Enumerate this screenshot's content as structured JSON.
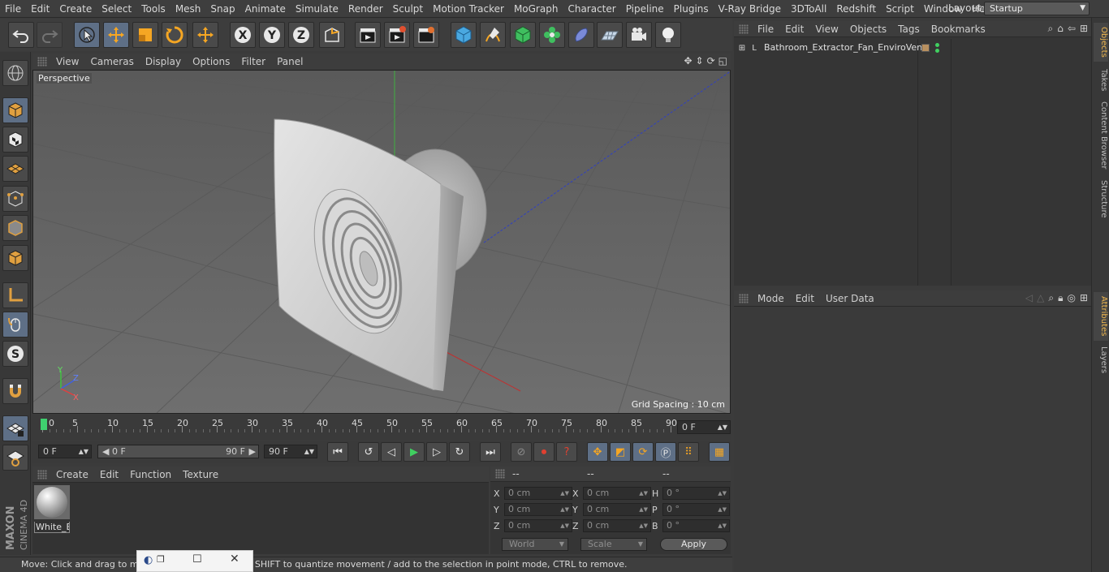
{
  "menu": [
    "File",
    "Edit",
    "Create",
    "Select",
    "Tools",
    "Mesh",
    "Snap",
    "Animate",
    "Simulate",
    "Render",
    "Sculpt",
    "Motion Tracker",
    "MoGraph",
    "Character",
    "Pipeline",
    "Plugins",
    "V-Ray Bridge",
    "3DToAll",
    "Redshift",
    "Script",
    "Window",
    "Help"
  ],
  "layout": {
    "label": "Layout:",
    "value": "Startup"
  },
  "viewport": {
    "menu": [
      "View",
      "Cameras",
      "Display",
      "Options",
      "Filter",
      "Panel"
    ],
    "label": "Perspective",
    "grid_spacing": "Grid Spacing : 10 cm",
    "axis_y": "Y",
    "axis_z": "Z",
    "axis_x": "X"
  },
  "timeline": {
    "ticks": [
      "0",
      "5",
      "10",
      "15",
      "20",
      "25",
      "30",
      "35",
      "40",
      "45",
      "50",
      "55",
      "60",
      "65",
      "70",
      "75",
      "80",
      "85",
      "90"
    ],
    "current_frame": "0 F",
    "start": "0 F",
    "range_start": "0 F",
    "range_end": "90 F",
    "end": "90 F"
  },
  "material_panel": {
    "menu": [
      "Create",
      "Edit",
      "Function",
      "Texture"
    ],
    "material_name": "White_E"
  },
  "coords": {
    "headers": [
      "--",
      "--",
      "--"
    ],
    "rows": [
      {
        "l1": "X",
        "v1": "0 cm",
        "l2": "X",
        "v2": "0 cm",
        "l3": "H",
        "v3": "0 °"
      },
      {
        "l1": "Y",
        "v1": "0 cm",
        "l2": "Y",
        "v2": "0 cm",
        "l3": "P",
        "v3": "0 °"
      },
      {
        "l1": "Z",
        "v1": "0 cm",
        "l2": "Z",
        "v2": "0 cm",
        "l3": "B",
        "v3": "0 °"
      }
    ],
    "mode": "World",
    "scale": "Scale",
    "apply": "Apply"
  },
  "status": "Move: Click and drag to move elements. Hold down SHIFT to quantize movement / add to the selection in point mode, CTRL to remove.",
  "objects_panel": {
    "menu": [
      "File",
      "Edit",
      "View",
      "Objects",
      "Tags",
      "Bookmarks"
    ],
    "object_name": "Bathroom_Extractor_Fan_EnviroVent"
  },
  "attributes_panel": {
    "menu": [
      "Mode",
      "Edit",
      "User Data"
    ]
  },
  "right_tabs": [
    "Objects",
    "Takes",
    "Content Browser",
    "Structure",
    "Attributes",
    "Layers"
  ],
  "brand": {
    "line1": "MAXON",
    "line2": "CINEMA 4D"
  },
  "colors": {
    "accent": "#5e6f86",
    "viewport_bg": "#6b6b6b",
    "active_tab": "#f0b850"
  }
}
